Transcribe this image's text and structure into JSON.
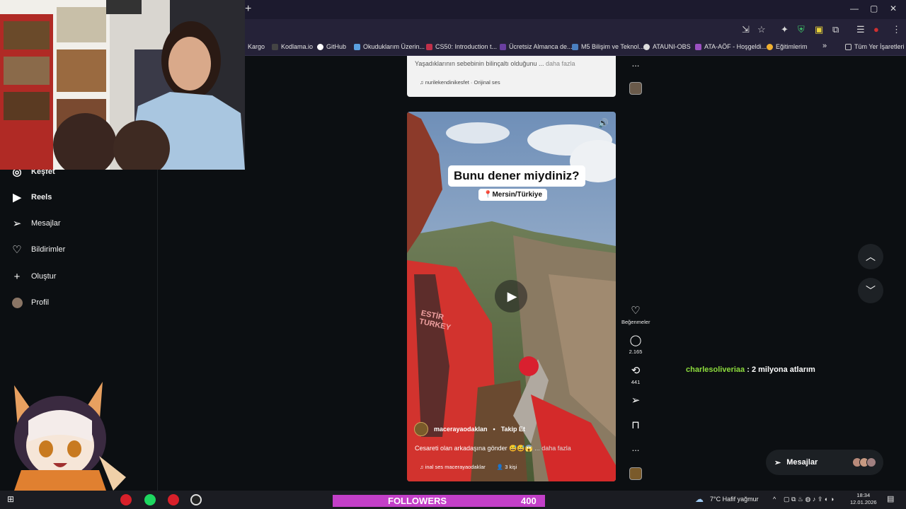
{
  "browser": {
    "new_tab_icon": "+",
    "window_controls": [
      "—",
      "▢",
      "✕"
    ],
    "url_icons": [
      "install-icon",
      "star-icon",
      "extension-icon",
      "shield-icon",
      "wallet-icon",
      "puzzle-icon",
      "list-icon",
      "profile-icon",
      "menu-icon"
    ],
    "bookmarks": [
      {
        "label": "Kargo",
        "color": "#8a8a8a"
      },
      {
        "label": "Kodlama.io",
        "color": "#444444"
      },
      {
        "label": "GitHub",
        "color": "#ffffff"
      },
      {
        "label": "Okuduklarım Üzerin...",
        "color": "#5aa0e0"
      },
      {
        "label": "CS50: Introduction t...",
        "color": "#c0304a"
      },
      {
        "label": "Ücretsiz Almanca de...",
        "color": "#6a3fa0"
      },
      {
        "label": "M5 Bilişim ve Teknol...",
        "color": "#4a7fc0"
      },
      {
        "label": "ATAUNI-OBS",
        "color": "#dddddd"
      },
      {
        "label": "ATA-AÖF - Hoşgeldi...",
        "color": "#9a50c0"
      },
      {
        "label": "Eğitimlerim",
        "color": "#f0b030"
      }
    ],
    "bookmarks_more": "»",
    "all_bookmarks": "Tüm Yer İşaretleri"
  },
  "sidebar": {
    "items": [
      {
        "label": "Keşfet",
        "icon": "compass-icon"
      },
      {
        "label": "Reels",
        "icon": "reels-icon"
      },
      {
        "label": "Mesajlar",
        "icon": "send-icon"
      },
      {
        "label": "Bildirimler",
        "icon": "heart-icon"
      },
      {
        "label": "Oluştur",
        "icon": "plus-icon"
      },
      {
        "label": "Profil",
        "icon": "avatar"
      }
    ]
  },
  "previous_post": {
    "caption": "Yaşadıklarının sebebinin bilinçaltı olduğunu ...",
    "caption_more": "daha fazla",
    "audio": "nurilekendinikesfet · Orijinal ses"
  },
  "reel": {
    "overlay_title": "Bunu dener miydiniz?",
    "overlay_location": "📍Mersin/Türkiye",
    "shirt_text": "ESTİR TURKEY",
    "username": "macerayaodaklan",
    "follow": "Takip Et",
    "separator": "•",
    "caption": "Cesareti olan arkadaşına gönder 😅😅😱",
    "caption_more": "... daha fazla",
    "audio": "inal ses  macerayaodaklar",
    "people": "3 kişi"
  },
  "actions": {
    "like_label": "Beğenmeler",
    "comments_count": "2.165",
    "reposts_count": "441",
    "more": "..."
  },
  "chat": {
    "user": "charlesoliveriaa",
    "message": " : 2 milyona atlarım"
  },
  "messages_button": {
    "label": "Mesajlar"
  },
  "taskbar": {
    "followers_label": "FOLLOWERS",
    "followers_count": "400",
    "weather": "7°C  Hafif yağmur",
    "time": "18:34",
    "date": "12.01.2026"
  },
  "colors": {
    "accent_followers": "#c33fc8",
    "chat_user": "#8ddc3d"
  }
}
